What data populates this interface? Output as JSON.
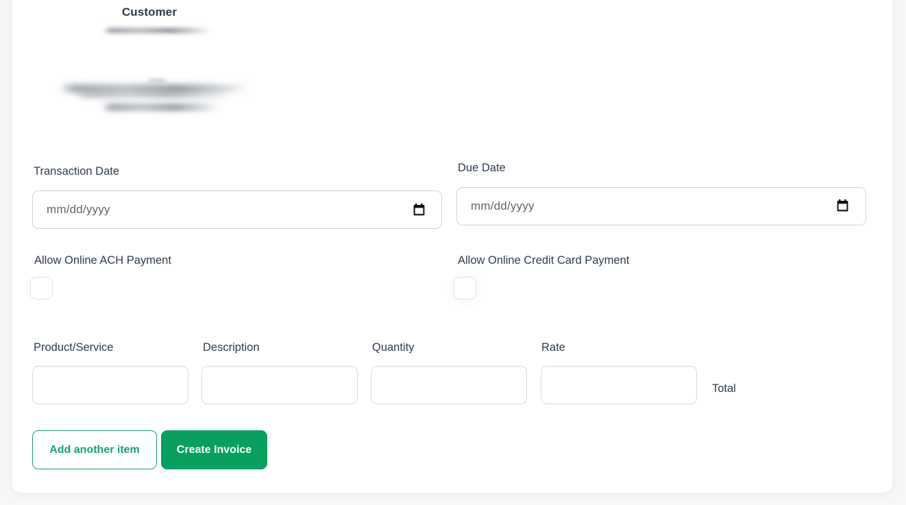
{
  "theme": {
    "page_background": "#f7f7f8",
    "card_background": "#ffffff",
    "label_color": "#2d3b4e",
    "input_border": "#ced4da",
    "accent_green": "#08a05f",
    "accent_green_outline": "#12a474"
  },
  "customer": {
    "heading": "Customer",
    "redacted": true
  },
  "dates": {
    "transaction": {
      "label": "Transaction Date",
      "value": "",
      "placeholder": "mm/dd/yyyy",
      "icon": "calendar-icon"
    },
    "due": {
      "label": "Due Date",
      "value": "",
      "placeholder": "mm/dd/yyyy",
      "icon": "calendar-icon"
    }
  },
  "payment_options": {
    "ach": {
      "label": "Allow Online ACH Payment",
      "checked": false
    },
    "credit_card": {
      "label": "Allow Online Credit Card Payment",
      "checked": false
    }
  },
  "line_items": {
    "columns": [
      {
        "label": "Product/Service",
        "value": ""
      },
      {
        "label": "Description",
        "value": ""
      },
      {
        "label": "Quantity",
        "value": ""
      },
      {
        "label": "Rate",
        "value": ""
      }
    ],
    "total_label": "Total",
    "total_value": ""
  },
  "actions": {
    "add_item_label": "Add another item",
    "create_invoice_label": "Create Invoice"
  }
}
